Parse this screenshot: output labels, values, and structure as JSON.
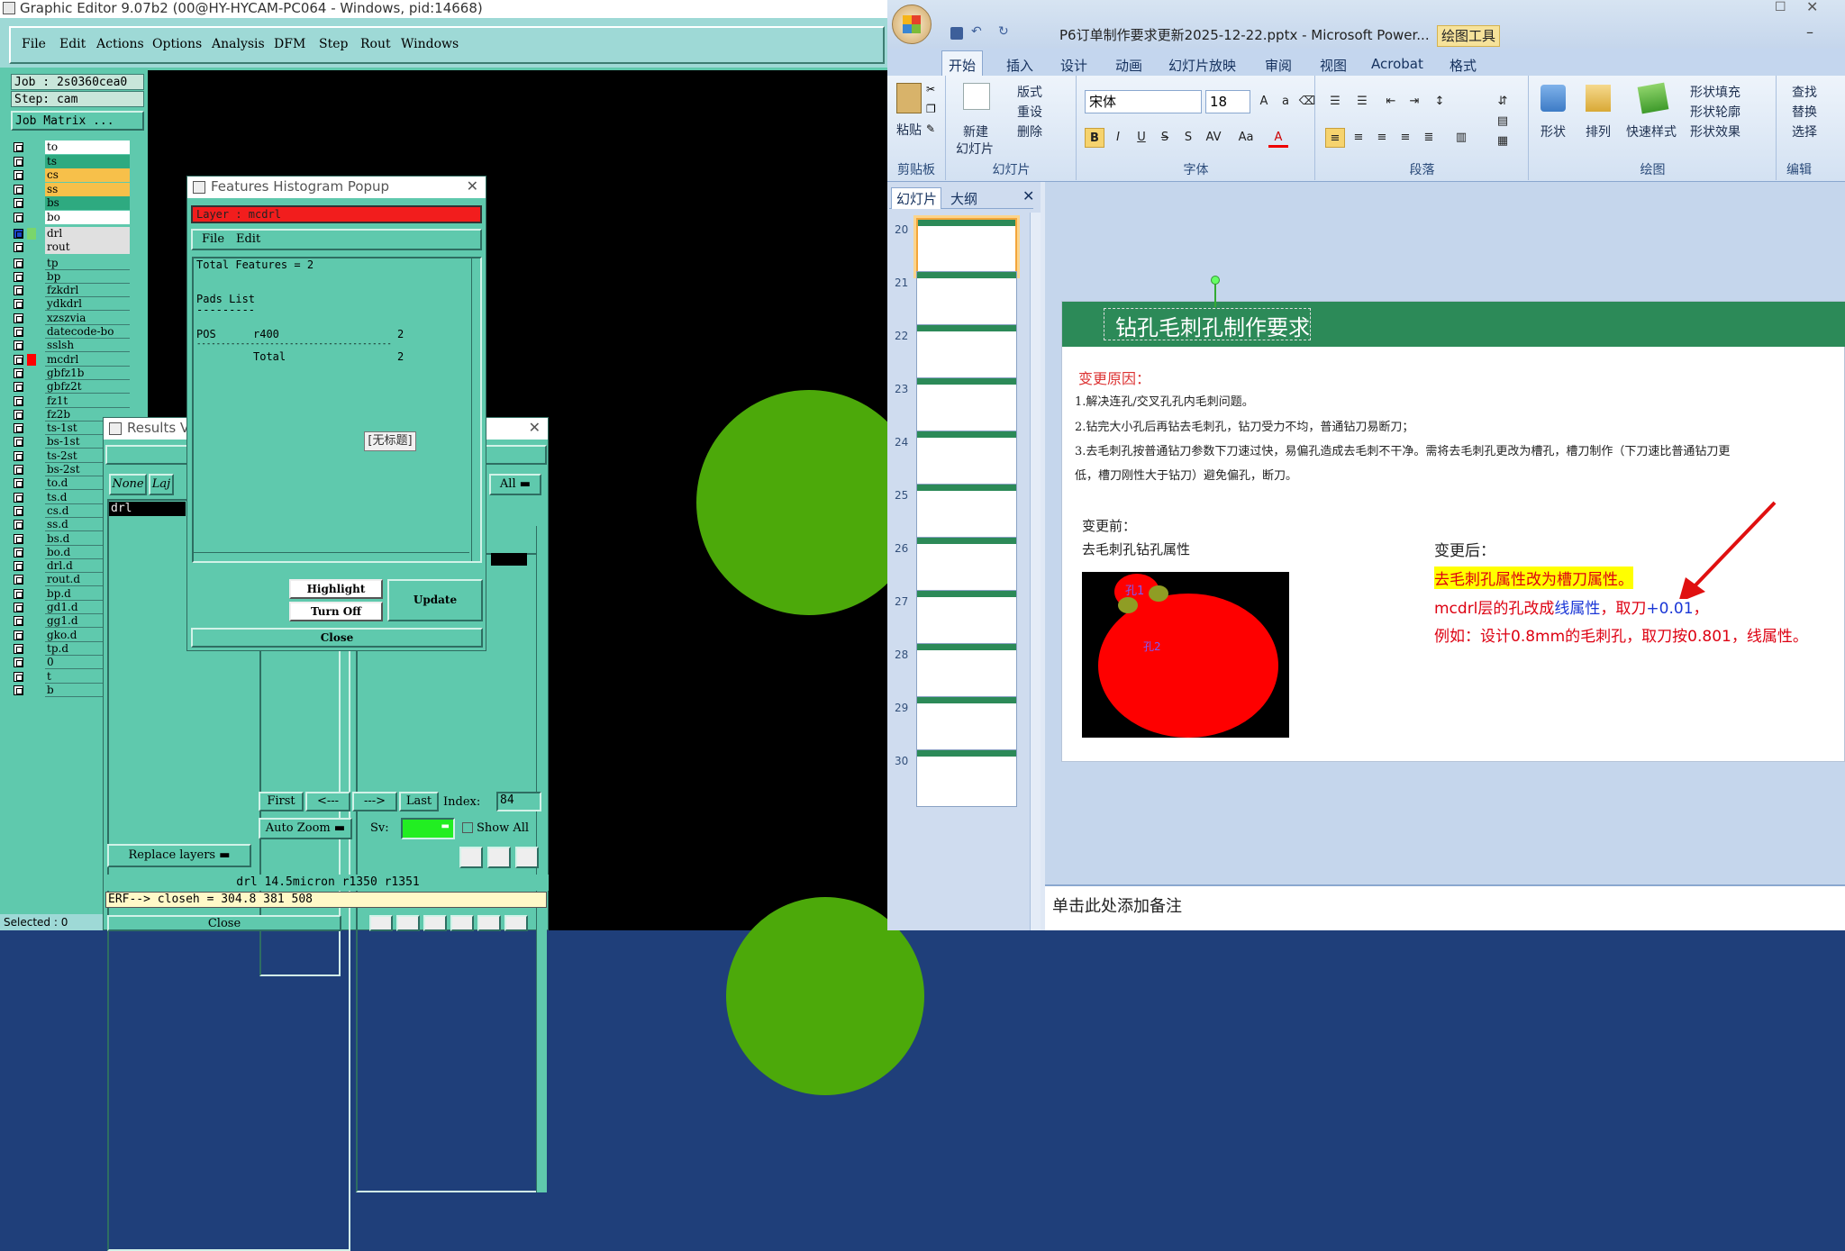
{
  "ge": {
    "title": "Graphic Editor 9.07b2 (00@HY-HYCAM-PC064 - Windows, pid:14668)",
    "menu": [
      "File",
      "Edit",
      "Actions",
      "Options",
      "Analysis",
      "DFM",
      "Step",
      "Rout",
      "Windows"
    ],
    "job": "Job : 2s0360cea0",
    "step": "Step: cam",
    "job_matrix": "Job Matrix ...",
    "layers": [
      "to",
      "ts",
      "cs",
      "ss",
      "bs",
      "bo",
      "drl",
      "rout",
      "tp",
      "bp",
      "fzkdrl",
      "ydkdrl",
      "xzszvia",
      "datecode-bo",
      "sslsh",
      "mcdrl",
      "gbfz1b",
      "gbfz2t",
      "fz1t",
      "fz2b",
      "ts-1st",
      "bs-1st",
      "ts-2st",
      "bs-2st",
      "to.d",
      "ts.d",
      "cs.d",
      "ss.d",
      "bs.d",
      "bo.d",
      "drl.d",
      "rout.d",
      "bp.d",
      "gd1.d",
      "gg1.d",
      "gko.d",
      "tp.d",
      "0",
      "t",
      "b"
    ],
    "layer_colors": {
      "to": "#ffffff",
      "ts": "#2eaa80",
      "cs": "#f7c04a",
      "ss": "#f7c04a",
      "bs": "#2eaa80",
      "bo": "#ffffff"
    },
    "selected_status": "Selected : 0"
  },
  "hist": {
    "title": "Features Histogram Popup",
    "layer": "Layer :  mcdrl",
    "menu": [
      "File",
      "Edit"
    ],
    "total": "Total Features = 2",
    "pads": "Pads List",
    "sep": "---------",
    "pos": "POS",
    "sym": "r400",
    "cnt": "2",
    "line": "----------------------------------------",
    "total_lbl": "Total",
    "total_cnt": "2",
    "tooltip": "[无标题]",
    "highlight": "Highlight",
    "turnoff": "Turn Off",
    "update": "Update",
    "close": "Close"
  },
  "results": {
    "title": "Results V",
    "none": "None",
    "lay": "Laj",
    "all": "All",
    "item": "drl",
    "first": "First",
    "prev": "<---",
    "next": "--->",
    "last": "Last",
    "index_lbl": "Index:",
    "index_val": "84",
    "autozoom": "Auto Zoom",
    "sv": "Sv:",
    "showall": "Show All",
    "replace": "Replace layers",
    "status1": "drl 14.5micron  r1350  r1351",
    "status2": "ERF--> closeh = 304.8 381 508",
    "close": "Close"
  },
  "pp": {
    "title": "P6订单制作要求更新2025-12-22.pptx - Microsoft Power...",
    "drawtools": "绘图工具",
    "tabs": [
      "开始",
      "插入",
      "设计",
      "动画",
      "幻灯片放映",
      "审阅",
      "视图",
      "Acrobat",
      "格式"
    ],
    "clipboard": {
      "label": "剪贴板",
      "paste": "粘贴"
    },
    "slides_grp": {
      "label": "幻灯片",
      "new": "新建",
      "new2": "幻灯片",
      "layout": "版式",
      "reset": "重设",
      "delete": "删除"
    },
    "font_grp": {
      "label": "字体",
      "font": "宋体",
      "size": "18"
    },
    "para_grp": {
      "label": "段落"
    },
    "draw_grp": {
      "label": "绘图",
      "shape": "形状",
      "arrange": "排列",
      "quick": "快速样式",
      "fill": "形状填充",
      "outline": "形状轮廓",
      "effect": "形状效果"
    },
    "edit_grp": {
      "label": "编辑",
      "find": "查找",
      "replace": "替换",
      "select": "选择"
    },
    "panel_tabs": [
      "幻灯片",
      "大纲"
    ],
    "thumb_nums": [
      "20",
      "21",
      "22",
      "23",
      "24",
      "25",
      "26",
      "27",
      "28",
      "29",
      "30"
    ],
    "notes": "单击此处添加备注"
  },
  "slide": {
    "title": "钻孔毛刺孔制作要求",
    "reason_lbl": "变更原因：",
    "reasons": [
      "1.解决连孔/交叉孔孔内毛刺问题。",
      "2.钻完大小孔后再钻去毛刺孔，钻刀受力不均，普通钻刀易断刀；",
      "3.去毛刺孔按普通钻刀参数下刀速过快，易偏孔造成去毛刺不干净。需将去毛刺孔更改为槽孔，槽刀制作（下刀速比普通钻刀更",
      "低，槽刀刚性大于钻刀）避免偏孔，断刀。"
    ],
    "before_lbl": "变更前：",
    "before_sub": "去毛刺孔钻孔属性",
    "hole1": "孔1",
    "hole2": "孔2",
    "after_lbl": "变更后：",
    "after1": "去毛刺孔属性改为槽刀属性。",
    "after2a": "mcdrl层的孔改成",
    "after2b": "线属性",
    "after2c": "，取刀",
    "after2d": "+0.01",
    "after2e": "，",
    "after3": "例如：设计0.8mm的毛刺孔，取刀按0.801，线属性。"
  }
}
